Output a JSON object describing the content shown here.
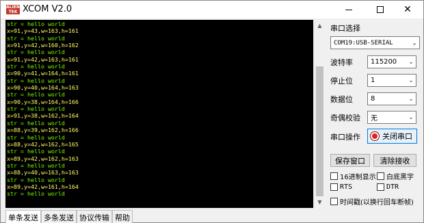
{
  "window": {
    "icon_text": "ALIEN TEK",
    "title": "XCOM V2.0"
  },
  "terminal": {
    "lines": [
      "str = hello world",
      "x=91,y=43,w=163,h=161",
      "str = hello world",
      "x=91,y=42,w=160,h=162",
      "str = hello world",
      "x=91,y=42,w=163,h=161",
      "str = hello world",
      "x=90,y=41,w=164,h=161",
      "str = hello world",
      "x=90,y=40,w=164,h=163",
      "str = hello world",
      "x=90,y=38,w=164,h=166",
      "str = hello world",
      "x=91,y=38,w=162,h=164",
      "str = hello world",
      "x=88,y=39,w=162,h=166",
      "str = hello world",
      "x=88,y=42,w=162,h=165",
      "str = hello world",
      "x=89,y=42,w=162,h=163",
      "str = hello world",
      "x=88,y=40,w=163,h=163",
      "str = hello world",
      "x=89,y=42,w=161,h=164",
      "str = hello world"
    ]
  },
  "tabs": [
    "单条发送",
    "多条发送",
    "协议传输",
    "帮助"
  ],
  "panel": {
    "port_select_label": "串口选择",
    "port_value": "COM19:USB-SERIAL",
    "baud_label": "波特率",
    "baud_value": "115200",
    "stopbits_label": "停止位",
    "stopbits_value": "1",
    "databits_label": "数据位",
    "databits_value": "8",
    "parity_label": "奇偶校验",
    "parity_value": "无",
    "serial_op_label": "串口操作",
    "close_port_label": "关闭串口",
    "save_window_label": "保存窗口",
    "clear_receive_label": "清除接收",
    "hex_display_label": "16进制显示",
    "white_bg_label": "白底黑字",
    "rts_label": "RTS",
    "dtr_label": "DTR",
    "timestamp_label": "时间戳(以换行回车断帧)"
  },
  "colors": {
    "terminal_bg": "#000000",
    "terminal_text": "#ffff66",
    "led_open": "#e02020"
  }
}
